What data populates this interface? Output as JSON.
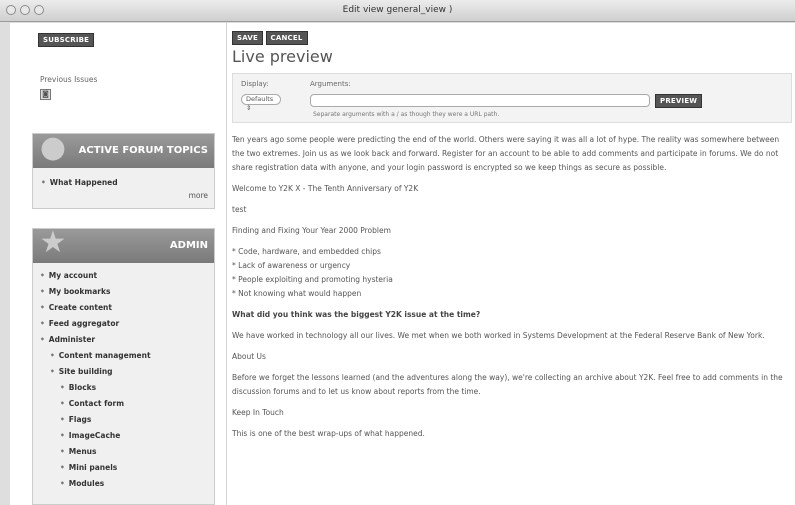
{
  "window": {
    "title": "Edit view general_view )"
  },
  "sidebar": {
    "subscribe_label": "SUBSCRIBE",
    "previous_issues": "Previous Issues",
    "forum_block": {
      "title": "ACTIVE FORUM TOPICS",
      "item": "What Happened",
      "more": "more"
    },
    "admin_block": {
      "title": "ADMIN"
    },
    "nav": [
      {
        "label": "My account"
      },
      {
        "label": "My bookmarks"
      },
      {
        "label": "Create content"
      },
      {
        "label": "Feed aggregator"
      },
      {
        "label": "Administer"
      },
      {
        "label": "Content management"
      },
      {
        "label": "Site building"
      },
      {
        "label": "Blocks"
      },
      {
        "label": "Contact form"
      },
      {
        "label": "Flags"
      },
      {
        "label": "ImageCache"
      },
      {
        "label": "Menus"
      },
      {
        "label": "Mini panels"
      },
      {
        "label": "Modules"
      }
    ]
  },
  "main": {
    "save_label": "SAVE",
    "cancel_label": "CANCEL",
    "heading": "Live preview",
    "display_label": "Display:",
    "display_value": "Defaults",
    "arguments_label": "Arguments:",
    "arguments_value": "",
    "preview_label": "PREVIEW",
    "arguments_help": "Separate arguments with a / as though they were a URL path.",
    "para1": "Ten years ago some people were predicting the end of the world. Others were saying it was all a lot of hype. The reality was somewhere between the two extremes. Join us as we look back and forward. Register for an account to be able to add comments and participate in forums. We do not share registration data with anyone, and your login password is encrypted so we keep things as secure as possible.",
    "welcome": "Welcome to Y2K X - The Tenth Anniversary of Y2K",
    "test": "test",
    "finding": "Finding and Fixing Your Year 2000 Problem",
    "list": [
      "* Code, hardware, and embedded chips",
      "* Lack of awareness or urgency",
      "* People exploiting and promoting hysteria",
      "* Not knowing what would happen"
    ],
    "question": "What did you think was the biggest Y2K issue at the time?",
    "para2": "We have worked in technology all our lives. We met when we both worked in Systems Development at the Federal Reserve Bank of New York.",
    "about": "About Us",
    "para3": "Before we forget the lessons learned (and the adventures along the way), we're collecting an archive about Y2K. Feel free to add comments in the discussion forums and to let us know about reports from the time.",
    "keep": "Keep In Touch",
    "para4": "This is one of the best wrap-ups of what happened."
  }
}
